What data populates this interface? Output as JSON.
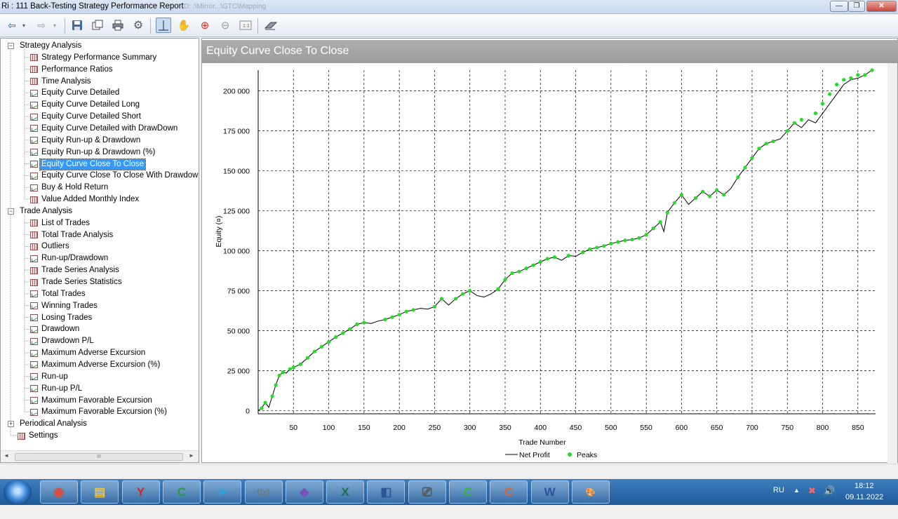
{
  "window": {
    "title": "Ri : 111 Back-Testing Strategy Performance Report",
    "ghost_text": "D: :\\Mirror...\\GTC\\Mapping"
  },
  "window_buttons": {
    "minimize": "—",
    "maximize": "❐",
    "close": "✕"
  },
  "tree": {
    "groups": [
      {
        "label": "Strategy Analysis",
        "expander": "−",
        "items": [
          {
            "label": "Strategy Performance Summary",
            "icon": "table-icon"
          },
          {
            "label": "Performance Ratios",
            "icon": "table-icon"
          },
          {
            "label": "Time Analysis",
            "icon": "table-icon"
          },
          {
            "label": "Equity Curve Detailed",
            "icon": "chart-icon"
          },
          {
            "label": "Equity Curve Detailed Long",
            "icon": "chart-icon"
          },
          {
            "label": "Equity Curve Detailed Short",
            "icon": "chart-icon"
          },
          {
            "label": "Equity Curve Detailed with DrawDown",
            "icon": "chart-icon"
          },
          {
            "label": "Equity Run-up & Drawdown",
            "icon": "chart-icon"
          },
          {
            "label": "Equity Run-up & Drawdown (%)",
            "icon": "chart-icon"
          },
          {
            "label": "Equity Curve Close To Close",
            "icon": "chart-icon",
            "selected": true
          },
          {
            "label": "Equity Curve Close To Close With Drawdown",
            "icon": "chart-icon"
          },
          {
            "label": "Buy & Hold Return",
            "icon": "chart-icon"
          },
          {
            "label": "Value Added Monthly Index",
            "icon": "table-icon"
          }
        ]
      },
      {
        "label": "Trade Analysis",
        "expander": "−",
        "items": [
          {
            "label": "List of Trades",
            "icon": "table-icon"
          },
          {
            "label": "Total Trade Analysis",
            "icon": "table-icon"
          },
          {
            "label": "Outliers",
            "icon": "table-icon"
          },
          {
            "label": "Run-up/Drawdown",
            "icon": "chart-icon"
          },
          {
            "label": "Trade Series Analysis",
            "icon": "table-icon"
          },
          {
            "label": "Trade Series Statistics",
            "icon": "table-icon"
          },
          {
            "label": "Total Trades",
            "icon": "chart-icon"
          },
          {
            "label": "Winning Trades",
            "icon": "chart-icon"
          },
          {
            "label": "Losing Trades",
            "icon": "chart-icon"
          },
          {
            "label": "Drawdown",
            "icon": "chart-icon"
          },
          {
            "label": "Drawdown P/L",
            "icon": "chart-icon"
          },
          {
            "label": "Maximum Adverse Excursion",
            "icon": "chart-icon"
          },
          {
            "label": "Maximum Adverse Excursion (%)",
            "icon": "chart-icon"
          },
          {
            "label": "Run-up",
            "icon": "chart-icon"
          },
          {
            "label": "Run-up P/L",
            "icon": "chart-icon"
          },
          {
            "label": "Maximum Favorable Excursion",
            "icon": "chart-icon"
          },
          {
            "label": "Maximum Favorable Excursion (%)",
            "icon": "chart-icon"
          }
        ]
      },
      {
        "label": "Periodical Analysis",
        "expander": "+",
        "items": []
      }
    ],
    "settings_label": "Settings",
    "scroll_thumb_grip": "III",
    "scroll_left": "◄",
    "scroll_right": "►"
  },
  "panel": {
    "title": "Equity Curve Close To Close"
  },
  "chart_data": {
    "type": "line",
    "title": "Equity Curve Close To Close",
    "xlabel": "Trade Number",
    "ylabel": "Equity (¤)",
    "xlim": [
      0,
      875
    ],
    "ylim": [
      -2000,
      213000
    ],
    "x_ticks": [
      "50",
      "100",
      "150",
      "200",
      "250",
      "300",
      "350",
      "400",
      "450",
      "500",
      "550",
      "600",
      "650",
      "700",
      "750",
      "800",
      "850"
    ],
    "y_ticks": [
      "0",
      "25 000",
      "50 000",
      "75 000",
      "100 000",
      "125 000",
      "150 000",
      "175 000",
      "200 000"
    ],
    "grid": true,
    "legend": {
      "placement": "bottom-center",
      "entries": [
        "Net Profit",
        "Peaks"
      ]
    },
    "colors": {
      "net_profit": "#000000",
      "peaks": "#22dd22"
    },
    "series": [
      {
        "name": "Net Profit",
        "x": [
          0,
          5,
          10,
          15,
          20,
          25,
          30,
          35,
          40,
          45,
          50,
          60,
          70,
          80,
          90,
          100,
          110,
          120,
          130,
          140,
          150,
          160,
          170,
          180,
          190,
          200,
          210,
          220,
          230,
          240,
          250,
          260,
          270,
          280,
          290,
          300,
          310,
          320,
          330,
          340,
          350,
          360,
          370,
          380,
          390,
          400,
          410,
          420,
          430,
          440,
          450,
          460,
          470,
          480,
          490,
          500,
          510,
          520,
          530,
          540,
          550,
          560,
          570,
          575,
          580,
          590,
          600,
          610,
          620,
          630,
          640,
          650,
          660,
          670,
          680,
          690,
          700,
          710,
          720,
          730,
          740,
          750,
          760,
          770,
          780,
          790,
          800,
          810,
          820,
          830,
          840,
          850,
          860,
          870
        ],
        "y": [
          0,
          1500,
          5000,
          2000,
          9000,
          16000,
          22000,
          24000,
          23500,
          26000,
          27000,
          29000,
          33000,
          37000,
          40000,
          43000,
          46000,
          48500,
          51000,
          54000,
          55000,
          54500,
          56000,
          57000,
          58500,
          60000,
          62000,
          63000,
          64000,
          63500,
          65000,
          70000,
          66000,
          70000,
          73000,
          75000,
          72000,
          71000,
          73000,
          76000,
          82000,
          86000,
          87000,
          89000,
          91000,
          93000,
          95000,
          96000,
          94000,
          97000,
          96500,
          99000,
          101000,
          102000,
          103000,
          104500,
          105500,
          106500,
          107000,
          108000,
          110000,
          114000,
          118000,
          112000,
          124000,
          130000,
          135000,
          129000,
          133000,
          137000,
          134000,
          138000,
          135000,
          139000,
          146000,
          152000,
          158000,
          164000,
          167000,
          168500,
          170000,
          175000,
          180000,
          177000,
          182000,
          180000,
          186000,
          192000,
          198000,
          204000,
          207000,
          208000,
          210000,
          213000
        ]
      },
      {
        "name": "Peaks",
        "x": [
          5,
          10,
          20,
          25,
          30,
          35,
          45,
          50,
          60,
          70,
          80,
          90,
          100,
          110,
          120,
          130,
          140,
          150,
          180,
          190,
          200,
          210,
          220,
          250,
          260,
          280,
          290,
          300,
          340,
          350,
          360,
          370,
          380,
          390,
          400,
          410,
          420,
          440,
          460,
          470,
          480,
          490,
          500,
          510,
          520,
          530,
          540,
          550,
          560,
          570,
          580,
          590,
          600,
          620,
          630,
          640,
          650,
          660,
          680,
          690,
          700,
          710,
          720,
          730,
          750,
          760,
          770,
          790,
          800,
          810,
          820,
          830,
          840,
          850,
          860,
          870
        ],
        "y": [
          1500,
          5000,
          9000,
          16000,
          22000,
          24000,
          26000,
          27000,
          29000,
          33000,
          37000,
          40000,
          43000,
          46000,
          48500,
          51000,
          54000,
          55000,
          57000,
          58500,
          60000,
          62000,
          63000,
          65000,
          70000,
          70000,
          73000,
          75000,
          76000,
          82000,
          86000,
          87000,
          89000,
          91000,
          93000,
          95000,
          96000,
          97000,
          99000,
          101000,
          102000,
          103000,
          104500,
          105500,
          106500,
          107000,
          108000,
          110000,
          114000,
          118000,
          124000,
          130000,
          135000,
          133000,
          137000,
          134000,
          138000,
          135000,
          146000,
          152000,
          158000,
          164000,
          167000,
          168500,
          175000,
          180000,
          182000,
          186000,
          192000,
          198000,
          204000,
          207000,
          208000,
          210000,
          210000,
          213000
        ]
      }
    ]
  },
  "taskbar": {
    "apps": [
      "chrome-icon",
      "explorer-icon",
      "yandex-icon",
      "ccleaner-icon",
      "telegram-icon",
      "formula-icon",
      "visual-studio-icon",
      "excel-icon",
      "network-icon",
      "document-icon",
      "camtasia-icon",
      "camtasia-rec-icon",
      "word-icon",
      "paint-icon"
    ],
    "app_glyphs": [
      "◉",
      "▤",
      "Y",
      "C",
      "➤",
      "f(x)",
      "◆",
      "X",
      "◧",
      "⎚",
      "C",
      "C",
      "W",
      "🎨"
    ],
    "app_colors": [
      "#dd4b39",
      "#e8c35a",
      "#d22",
      "#2a9d3a",
      "#2aa1da",
      "#777",
      "#7b4fb8",
      "#1e7145",
      "#2b5797",
      "#555",
      "#3bb33b",
      "#e0643a",
      "#2b579a",
      "#7ab"
    ],
    "language": "RU",
    "show_hidden": "▲",
    "time": "18:12",
    "date": "09.11.2022"
  }
}
